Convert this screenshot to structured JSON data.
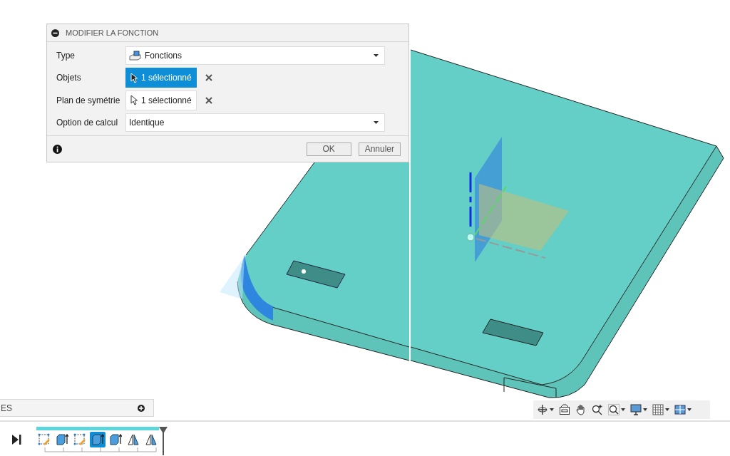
{
  "dialog": {
    "title": "MODIFIER LA FONCTION",
    "fields": [
      {
        "kind": "dropdown",
        "label": "Type",
        "value": "Fonctions",
        "icon": true
      },
      {
        "kind": "selection",
        "label": "Objets",
        "value": "1 sélectionné",
        "selected": true
      },
      {
        "kind": "selection",
        "label": "Plan de symétrie",
        "value": "1 sélectionné",
        "selected": false
      },
      {
        "kind": "dropdown",
        "label": "Option de calcul",
        "value": "Identique",
        "icon": false
      }
    ],
    "buttons": [
      "OK",
      "Annuler"
    ]
  },
  "browser_panel": {
    "title": "ES"
  },
  "navigation_toolbar": [
    {
      "kind": "orbit",
      "caret": true
    },
    {
      "kind": "look",
      "caret": false
    },
    {
      "kind": "pan",
      "caret": false
    },
    {
      "kind": "zoom",
      "caret": false
    },
    {
      "kind": "fit",
      "caret": true
    },
    {
      "kind": "display",
      "caret": true
    },
    {
      "kind": "grid",
      "caret": true
    },
    {
      "kind": "viewports",
      "caret": true
    }
  ],
  "timeline": {
    "items": [
      {
        "kind": "sketch",
        "selected": false
      },
      {
        "kind": "extrude",
        "selected": false
      },
      {
        "kind": "sketch",
        "selected": false
      },
      {
        "kind": "extrude",
        "selected": true
      },
      {
        "kind": "extrude",
        "selected": false
      },
      {
        "kind": "mirror",
        "selected": false
      },
      {
        "kind": "mirror",
        "selected": false
      }
    ]
  }
}
